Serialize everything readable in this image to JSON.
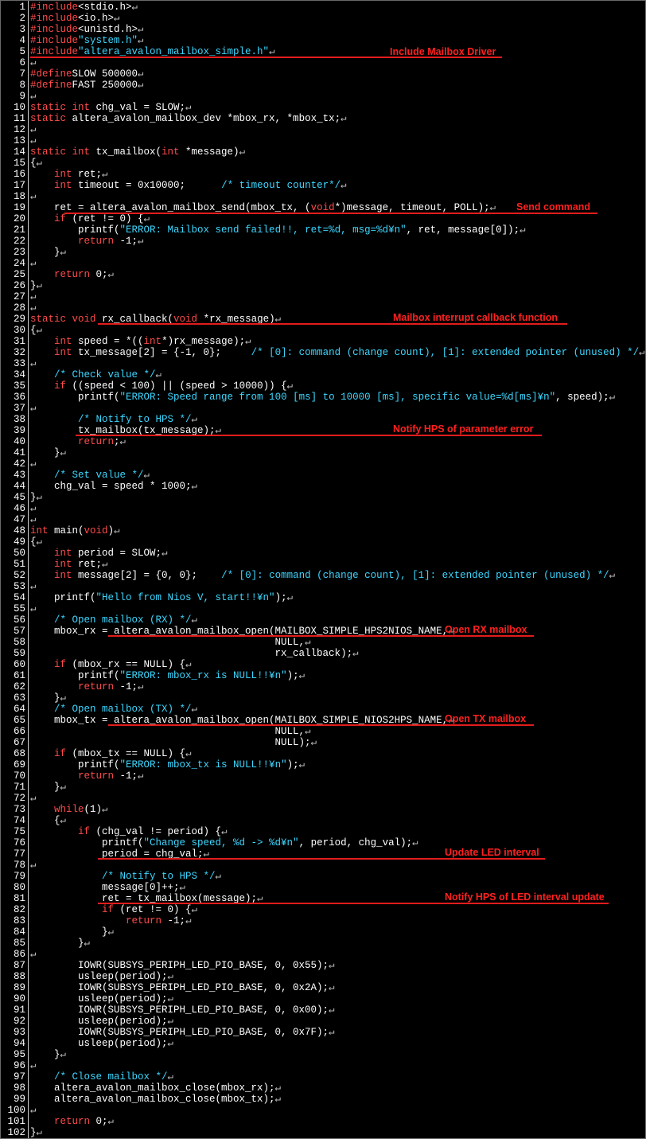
{
  "colors": {
    "background": "#000000",
    "text": "#ffffff",
    "keyword": "#ff4b4b",
    "string": "#3cd7ff",
    "annotation": "#ff2020",
    "underline": "#e21c1c"
  },
  "return_marker": "↵",
  "lines": [
    {
      "n": "1",
      "spans": [
        [
          "kw",
          "#include"
        ],
        [
          "",
          "<stdio.h>"
        ]
      ]
    },
    {
      "n": "2",
      "spans": [
        [
          "kw",
          "#include"
        ],
        [
          "",
          "<io.h>"
        ]
      ]
    },
    {
      "n": "3",
      "spans": [
        [
          "kw",
          "#include"
        ],
        [
          "",
          "<unistd.h>"
        ]
      ]
    },
    {
      "n": "4",
      "spans": [
        [
          "kw",
          "#include"
        ],
        [
          "str",
          "\"system.h\""
        ]
      ]
    },
    {
      "n": "5",
      "spans": [
        [
          "kw",
          "#include"
        ],
        [
          "str",
          "\"altera_avalon_mailbox_simple.h\""
        ]
      ]
    },
    {
      "n": "6",
      "spans": []
    },
    {
      "n": "7",
      "spans": [
        [
          "kw",
          "#define"
        ],
        [
          "",
          "SLOW 500000"
        ]
      ]
    },
    {
      "n": "8",
      "spans": [
        [
          "kw",
          "#define"
        ],
        [
          "",
          "FAST 250000"
        ]
      ]
    },
    {
      "n": "9",
      "spans": []
    },
    {
      "n": "10",
      "spans": [
        [
          "kw",
          "static int"
        ],
        [
          "",
          " chg_val = SLOW;"
        ]
      ]
    },
    {
      "n": "11",
      "spans": [
        [
          "kw",
          "static"
        ],
        [
          "",
          " altera_avalon_mailbox_dev *mbox_rx, *mbox_tx;"
        ]
      ]
    },
    {
      "n": "12",
      "spans": []
    },
    {
      "n": "13",
      "spans": []
    },
    {
      "n": "14",
      "spans": [
        [
          "kw",
          "static int"
        ],
        [
          "",
          " tx_mailbox("
        ],
        [
          "kw",
          "int"
        ],
        [
          "",
          " *message)"
        ]
      ]
    },
    {
      "n": "15",
      "spans": [
        [
          "",
          "{"
        ]
      ]
    },
    {
      "n": "16",
      "spans": [
        [
          "",
          "    "
        ],
        [
          "kw",
          "int"
        ],
        [
          "",
          " ret;"
        ]
      ]
    },
    {
      "n": "17",
      "spans": [
        [
          "",
          "    "
        ],
        [
          "kw",
          "int"
        ],
        [
          "",
          " timeout = 0x10000;      "
        ],
        [
          "cm",
          "/* timeout counter*/"
        ]
      ]
    },
    {
      "n": "18",
      "spans": []
    },
    {
      "n": "19",
      "spans": [
        [
          "",
          "    ret = altera_avalon_mailbox_send(mbox_tx, ("
        ],
        [
          "kw",
          "void"
        ],
        [
          "",
          "*)message, timeout, POLL);"
        ]
      ]
    },
    {
      "n": "20",
      "spans": [
        [
          "",
          "    "
        ],
        [
          "kw",
          "if"
        ],
        [
          "",
          " (ret != 0) {"
        ]
      ]
    },
    {
      "n": "21",
      "spans": [
        [
          "",
          "        printf("
        ],
        [
          "str",
          "\"ERROR: Mailbox send failed!!, ret=%d, msg=%d¥n\""
        ],
        [
          "",
          ", ret, message[0]);"
        ]
      ]
    },
    {
      "n": "22",
      "spans": [
        [
          "",
          "        "
        ],
        [
          "kw",
          "return"
        ],
        [
          "",
          " -1;"
        ]
      ]
    },
    {
      "n": "23",
      "spans": [
        [
          "",
          "    }"
        ]
      ]
    },
    {
      "n": "24",
      "spans": []
    },
    {
      "n": "25",
      "spans": [
        [
          "",
          "    "
        ],
        [
          "kw",
          "return"
        ],
        [
          "",
          " 0;"
        ]
      ]
    },
    {
      "n": "26",
      "spans": [
        [
          "",
          "}"
        ]
      ]
    },
    {
      "n": "27",
      "spans": []
    },
    {
      "n": "28",
      "spans": []
    },
    {
      "n": "29",
      "spans": [
        [
          "kw",
          "static void"
        ],
        [
          "",
          " rx_callback("
        ],
        [
          "kw",
          "void"
        ],
        [
          "",
          " *rx_message)"
        ]
      ]
    },
    {
      "n": "30",
      "spans": [
        [
          "",
          "{"
        ]
      ]
    },
    {
      "n": "31",
      "spans": [
        [
          "",
          "    "
        ],
        [
          "kw",
          "int"
        ],
        [
          "",
          " speed = *(("
        ],
        [
          "kw",
          "int"
        ],
        [
          "",
          "*)rx_message);"
        ]
      ]
    },
    {
      "n": "32",
      "spans": [
        [
          "",
          "    "
        ],
        [
          "kw",
          "int"
        ],
        [
          "",
          " tx_message[2] = {-1, 0};     "
        ],
        [
          "cm",
          "/* [0]: command (change count), [1]: extended pointer (unused) */"
        ]
      ]
    },
    {
      "n": "33",
      "spans": []
    },
    {
      "n": "34",
      "spans": [
        [
          "",
          "    "
        ],
        [
          "cm",
          "/* Check value */"
        ]
      ]
    },
    {
      "n": "35",
      "spans": [
        [
          "",
          "    "
        ],
        [
          "kw",
          "if"
        ],
        [
          "",
          " ((speed < 100) || (speed > 10000)) {"
        ]
      ]
    },
    {
      "n": "36",
      "spans": [
        [
          "",
          "        printf("
        ],
        [
          "str",
          "\"ERROR: Speed range from 100 [ms] to 10000 [ms], specific value=%d[ms]¥n\""
        ],
        [
          "",
          ", speed);"
        ]
      ]
    },
    {
      "n": "37",
      "spans": []
    },
    {
      "n": "38",
      "spans": [
        [
          "",
          "        "
        ],
        [
          "cm",
          "/* Notify to HPS */"
        ]
      ]
    },
    {
      "n": "39",
      "spans": [
        [
          "",
          "        tx_mailbox(tx_message);"
        ]
      ]
    },
    {
      "n": "40",
      "spans": [
        [
          "",
          "        "
        ],
        [
          "kw",
          "return"
        ],
        [
          "",
          ";"
        ]
      ]
    },
    {
      "n": "41",
      "spans": [
        [
          "",
          "    }"
        ]
      ]
    },
    {
      "n": "42",
      "spans": []
    },
    {
      "n": "43",
      "spans": [
        [
          "",
          "    "
        ],
        [
          "cm",
          "/* Set value */"
        ]
      ]
    },
    {
      "n": "44",
      "spans": [
        [
          "",
          "    chg_val = speed * 1000;"
        ]
      ]
    },
    {
      "n": "45",
      "spans": [
        [
          "",
          "}"
        ]
      ]
    },
    {
      "n": "46",
      "spans": []
    },
    {
      "n": "47",
      "spans": []
    },
    {
      "n": "48",
      "spans": [
        [
          "kw",
          "int"
        ],
        [
          "",
          " main("
        ],
        [
          "kw",
          "void"
        ],
        [
          "",
          ")"
        ]
      ]
    },
    {
      "n": "49",
      "spans": [
        [
          "",
          "{"
        ]
      ]
    },
    {
      "n": "50",
      "spans": [
        [
          "",
          "    "
        ],
        [
          "kw",
          "int"
        ],
        [
          "",
          " period = SLOW;"
        ]
      ]
    },
    {
      "n": "51",
      "spans": [
        [
          "",
          "    "
        ],
        [
          "kw",
          "int"
        ],
        [
          "",
          " ret;"
        ]
      ]
    },
    {
      "n": "52",
      "spans": [
        [
          "",
          "    "
        ],
        [
          "kw",
          "int"
        ],
        [
          "",
          " message[2] = {0, 0};    "
        ],
        [
          "cm",
          "/* [0]: command (change count), [1]: extended pointer (unused) */"
        ]
      ]
    },
    {
      "n": "53",
      "spans": []
    },
    {
      "n": "54",
      "spans": [
        [
          "",
          "    printf("
        ],
        [
          "str",
          "\"Hello from Nios V, start!!¥n\""
        ],
        [
          "",
          ");"
        ]
      ]
    },
    {
      "n": "55",
      "spans": []
    },
    {
      "n": "56",
      "spans": [
        [
          "",
          "    "
        ],
        [
          "cm",
          "/* Open mailbox (RX) */"
        ]
      ]
    },
    {
      "n": "57",
      "spans": [
        [
          "",
          "    mbox_rx = altera_avalon_mailbox_open(MAILBOX_SIMPLE_HPS2NIOS_NAME,"
        ]
      ]
    },
    {
      "n": "58",
      "spans": [
        [
          "",
          "                                         NULL,"
        ]
      ]
    },
    {
      "n": "59",
      "spans": [
        [
          "",
          "                                         rx_callback);"
        ]
      ]
    },
    {
      "n": "60",
      "spans": [
        [
          "",
          "    "
        ],
        [
          "kw",
          "if"
        ],
        [
          "",
          " (mbox_rx == NULL) {"
        ]
      ]
    },
    {
      "n": "61",
      "spans": [
        [
          "",
          "        printf("
        ],
        [
          "str",
          "\"ERROR: mbox_rx is NULL!!¥n\""
        ],
        [
          "",
          ");"
        ]
      ]
    },
    {
      "n": "62",
      "spans": [
        [
          "",
          "        "
        ],
        [
          "kw",
          "return"
        ],
        [
          "",
          " -1;"
        ]
      ]
    },
    {
      "n": "63",
      "spans": [
        [
          "",
          "    }"
        ]
      ]
    },
    {
      "n": "64",
      "spans": [
        [
          "",
          "    "
        ],
        [
          "cm",
          "/* Open mailbox (TX) */"
        ]
      ]
    },
    {
      "n": "65",
      "spans": [
        [
          "",
          "    mbox_tx = altera_avalon_mailbox_open(MAILBOX_SIMPLE_NIOS2HPS_NAME,"
        ]
      ]
    },
    {
      "n": "66",
      "spans": [
        [
          "",
          "                                         NULL,"
        ]
      ]
    },
    {
      "n": "67",
      "spans": [
        [
          "",
          "                                         NULL);"
        ]
      ]
    },
    {
      "n": "68",
      "spans": [
        [
          "",
          "    "
        ],
        [
          "kw",
          "if"
        ],
        [
          "",
          " (mbox_tx == NULL) {"
        ]
      ]
    },
    {
      "n": "69",
      "spans": [
        [
          "",
          "        printf("
        ],
        [
          "str",
          "\"ERROR: mbox_tx is NULL!!¥n\""
        ],
        [
          "",
          ");"
        ]
      ]
    },
    {
      "n": "70",
      "spans": [
        [
          "",
          "        "
        ],
        [
          "kw",
          "return"
        ],
        [
          "",
          " -1;"
        ]
      ]
    },
    {
      "n": "71",
      "spans": [
        [
          "",
          "    }"
        ]
      ]
    },
    {
      "n": "72",
      "spans": []
    },
    {
      "n": "73",
      "spans": [
        [
          "",
          "    "
        ],
        [
          "kw",
          "while"
        ],
        [
          "",
          "(1)"
        ]
      ]
    },
    {
      "n": "74",
      "spans": [
        [
          "",
          "    {"
        ]
      ]
    },
    {
      "n": "75",
      "spans": [
        [
          "",
          "        "
        ],
        [
          "kw",
          "if"
        ],
        [
          "",
          " (chg_val != period) {"
        ]
      ]
    },
    {
      "n": "76",
      "spans": [
        [
          "",
          "            printf("
        ],
        [
          "str",
          "\"Change speed, %d -> %d¥n\""
        ],
        [
          "",
          ", period, chg_val);"
        ]
      ]
    },
    {
      "n": "77",
      "spans": [
        [
          "",
          "            period = chg_val;"
        ]
      ]
    },
    {
      "n": "78",
      "spans": []
    },
    {
      "n": "79",
      "spans": [
        [
          "",
          "            "
        ],
        [
          "cm",
          "/* Notify to HPS */"
        ]
      ]
    },
    {
      "n": "80",
      "spans": [
        [
          "",
          "            message[0]++;"
        ]
      ]
    },
    {
      "n": "81",
      "spans": [
        [
          "",
          "            ret = tx_mailbox(message);"
        ]
      ]
    },
    {
      "n": "82",
      "spans": [
        [
          "",
          "            "
        ],
        [
          "kw",
          "if"
        ],
        [
          "",
          " (ret != 0) {"
        ]
      ]
    },
    {
      "n": "83",
      "spans": [
        [
          "",
          "                "
        ],
        [
          "kw",
          "return"
        ],
        [
          "",
          " -1;"
        ]
      ]
    },
    {
      "n": "84",
      "spans": [
        [
          "",
          "            }"
        ]
      ]
    },
    {
      "n": "85",
      "spans": [
        [
          "",
          "        }"
        ]
      ]
    },
    {
      "n": "86",
      "spans": []
    },
    {
      "n": "87",
      "spans": [
        [
          "",
          "        IOWR(SUBSYS_PERIPH_LED_PIO_BASE, 0, 0x55);"
        ]
      ]
    },
    {
      "n": "88",
      "spans": [
        [
          "",
          "        usleep(period);"
        ]
      ]
    },
    {
      "n": "89",
      "spans": [
        [
          "",
          "        IOWR(SUBSYS_PERIPH_LED_PIO_BASE, 0, 0x2A);"
        ]
      ]
    },
    {
      "n": "90",
      "spans": [
        [
          "",
          "        usleep(period);"
        ]
      ]
    },
    {
      "n": "91",
      "spans": [
        [
          "",
          "        IOWR(SUBSYS_PERIPH_LED_PIO_BASE, 0, 0x00);"
        ]
      ]
    },
    {
      "n": "92",
      "spans": [
        [
          "",
          "        usleep(period);"
        ]
      ]
    },
    {
      "n": "93",
      "spans": [
        [
          "",
          "        IOWR(SUBSYS_PERIPH_LED_PIO_BASE, 0, 0x7F);"
        ]
      ]
    },
    {
      "n": "94",
      "spans": [
        [
          "",
          "        usleep(period);"
        ]
      ]
    },
    {
      "n": "95",
      "spans": [
        [
          "",
          "    }"
        ]
      ]
    },
    {
      "n": "96",
      "spans": []
    },
    {
      "n": "97",
      "spans": [
        [
          "",
          "    "
        ],
        [
          "cm",
          "/* Close mailbox */"
        ]
      ]
    },
    {
      "n": "98",
      "spans": [
        [
          "",
          "    altera_avalon_mailbox_close(mbox_rx);"
        ]
      ]
    },
    {
      "n": "99",
      "spans": [
        [
          "",
          "    altera_avalon_mailbox_close(mbox_tx);"
        ]
      ]
    },
    {
      "n": "100",
      "spans": []
    },
    {
      "n": "101",
      "spans": [
        [
          "",
          "    "
        ],
        [
          "kw",
          "return"
        ],
        [
          "",
          " 0;"
        ]
      ]
    },
    {
      "n": "102",
      "spans": [
        [
          "",
          "}"
        ]
      ]
    }
  ],
  "annotations": [
    {
      "line": "5",
      "text": "Include Mailbox Driver"
    },
    {
      "line": "19",
      "text": "Send command"
    },
    {
      "line": "29",
      "text": "Mailbox interrupt callback function"
    },
    {
      "line": "39",
      "text": "Notify HPS of parameter error"
    },
    {
      "line": "57",
      "text": "Open RX mailbox"
    },
    {
      "line": "65",
      "text": "Open TX mailbox"
    },
    {
      "line": "77",
      "text": "Update LED interval"
    },
    {
      "line": "81",
      "text": "Notify HPS of LED interval update"
    }
  ]
}
